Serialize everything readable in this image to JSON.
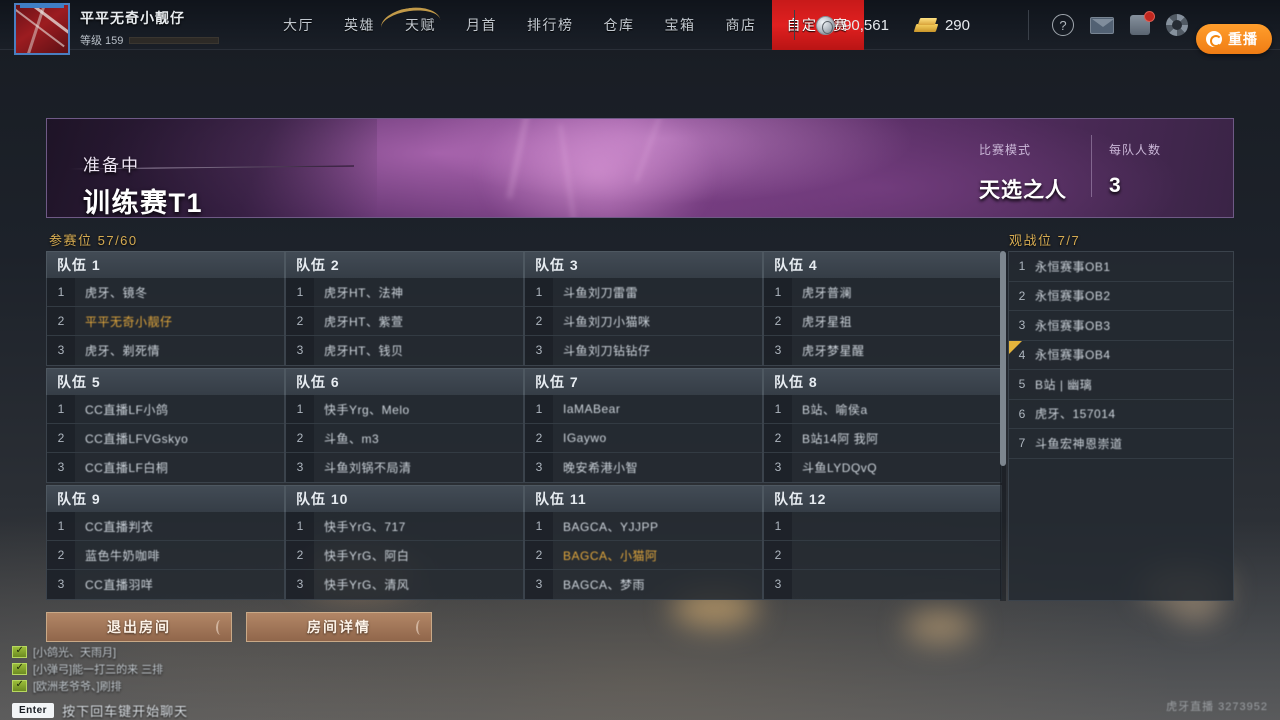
{
  "topbar": {
    "player_name": "平平无奇小靓仔",
    "level_label": "等级 159",
    "nav_items": [
      {
        "label": "大厅",
        "active": false
      },
      {
        "label": "英雄",
        "active": false
      },
      {
        "label": "天赋",
        "active": false
      },
      {
        "label": "月首",
        "active": false
      },
      {
        "label": "排行榜",
        "active": false
      },
      {
        "label": "仓库",
        "active": false
      },
      {
        "label": "宝箱",
        "active": false
      },
      {
        "label": "商店",
        "active": false
      },
      {
        "label": "自定义赛",
        "active": true
      }
    ],
    "currency": [
      {
        "icon": "silver-coin-icon",
        "value": "90,561"
      },
      {
        "icon": "gold-bar-icon",
        "value": "290"
      }
    ],
    "help_icon": "?",
    "replay_button": "重播"
  },
  "banner": {
    "status": "准备中",
    "title": "训练赛T1",
    "stats": [
      {
        "label": "比赛模式",
        "value": "天选之人"
      },
      {
        "label": "每队人数",
        "value": "3"
      }
    ]
  },
  "slots": {
    "participants_label": "参赛位  57/60",
    "spectators_label": "观战位  7/7"
  },
  "teams": [
    {
      "name": "队伍 1",
      "players": [
        {
          "num": "1",
          "name": "虎牙、镜冬",
          "me": false
        },
        {
          "num": "2",
          "name": "平平无奇小靓仔",
          "me": true
        },
        {
          "num": "3",
          "name": "虎牙、剃死情",
          "me": false
        }
      ]
    },
    {
      "name": "队伍 2",
      "players": [
        {
          "num": "1",
          "name": "虎牙HT、法神",
          "me": false
        },
        {
          "num": "2",
          "name": "虎牙HT、紫萱",
          "me": false
        },
        {
          "num": "3",
          "name": "虎牙HT、钱贝",
          "me": false
        }
      ]
    },
    {
      "name": "队伍 3",
      "players": [
        {
          "num": "1",
          "name": "斗鱼刘刀雷雷",
          "me": false
        },
        {
          "num": "2",
          "name": "斗鱼刘刀小猫咪",
          "me": false
        },
        {
          "num": "3",
          "name": "斗鱼刘刀钻钻仔",
          "me": false
        }
      ]
    },
    {
      "name": "队伍 4",
      "players": [
        {
          "num": "1",
          "name": "虎牙普澜",
          "me": false
        },
        {
          "num": "2",
          "name": "虎牙星祖",
          "me": false
        },
        {
          "num": "3",
          "name": "虎牙梦星醒",
          "me": false
        }
      ]
    },
    {
      "name": "队伍 5",
      "players": [
        {
          "num": "1",
          "name": "CC直播LF小鸽",
          "me": false
        },
        {
          "num": "2",
          "name": "CC直播LFVGskyo",
          "me": false
        },
        {
          "num": "3",
          "name": "CC直播LF白桐",
          "me": false
        }
      ]
    },
    {
      "name": "队伍 6",
      "players": [
        {
          "num": "1",
          "name": "快手Yrg、Melo",
          "me": false
        },
        {
          "num": "2",
          "name": "斗鱼、m3",
          "me": false
        },
        {
          "num": "3",
          "name": "斗鱼刘锅不局清",
          "me": false
        }
      ]
    },
    {
      "name": "队伍 7",
      "players": [
        {
          "num": "1",
          "name": "IaMABear",
          "me": false
        },
        {
          "num": "2",
          "name": "IGaywo",
          "me": false
        },
        {
          "num": "3",
          "name": "晚安希港小智",
          "me": false
        }
      ]
    },
    {
      "name": "队伍 8",
      "players": [
        {
          "num": "1",
          "name": "B站、喻侯a",
          "me": false
        },
        {
          "num": "2",
          "name": "B站14阿 我阿",
          "me": false
        },
        {
          "num": "3",
          "name": "斗鱼LYDQvQ",
          "me": false
        }
      ]
    },
    {
      "name": "队伍 9",
      "players": [
        {
          "num": "1",
          "name": "CC直播判衣",
          "me": false
        },
        {
          "num": "2",
          "name": "蓝色牛奶咖啡",
          "me": false
        },
        {
          "num": "3",
          "name": "CC直播羽咩",
          "me": false
        }
      ]
    },
    {
      "name": "队伍 10",
      "players": [
        {
          "num": "1",
          "name": "快手YrG、717",
          "me": false
        },
        {
          "num": "2",
          "name": "快手YrG、阿白",
          "me": false
        },
        {
          "num": "3",
          "name": "快手YrG、清风",
          "me": false
        }
      ]
    },
    {
      "name": "队伍 11",
      "players": [
        {
          "num": "1",
          "name": "BAGCA、YJJPP",
          "me": false
        },
        {
          "num": "2",
          "name": "BAGCA、小猫阿",
          "me": true
        },
        {
          "num": "3",
          "name": "BAGCA、梦雨",
          "me": false
        }
      ]
    },
    {
      "name": "队伍 12",
      "players": [
        {
          "num": "1",
          "name": "",
          "me": false
        },
        {
          "num": "2",
          "name": "",
          "me": false
        },
        {
          "num": "3",
          "name": "",
          "me": false
        }
      ]
    }
  ],
  "spectators": [
    {
      "num": "1",
      "name": "永恒赛事OB1",
      "marked": false
    },
    {
      "num": "2",
      "name": "永恒赛事OB2",
      "marked": false
    },
    {
      "num": "3",
      "name": "永恒赛事OB3",
      "marked": false
    },
    {
      "num": "4",
      "name": "永恒赛事OB4",
      "marked": true
    },
    {
      "num": "5",
      "name": "B站 | 幽璃",
      "marked": false
    },
    {
      "num": "6",
      "name": "虎牙、157014",
      "marked": false
    },
    {
      "num": "7",
      "name": "斗鱼宏神恩崇道",
      "marked": false
    }
  ],
  "buttons": {
    "leave_room": "退出房间",
    "room_details": "房间详情"
  },
  "chat": {
    "lines": [
      "[小鸽光、天雨月]",
      "[小弹弓]能一打三的来  三排",
      "[欧洲老爷爷、]刷排"
    ],
    "enter_key": "Enter",
    "hint": "按下回车键开始聊天"
  },
  "watermark": "虎牙直播 3273952"
}
